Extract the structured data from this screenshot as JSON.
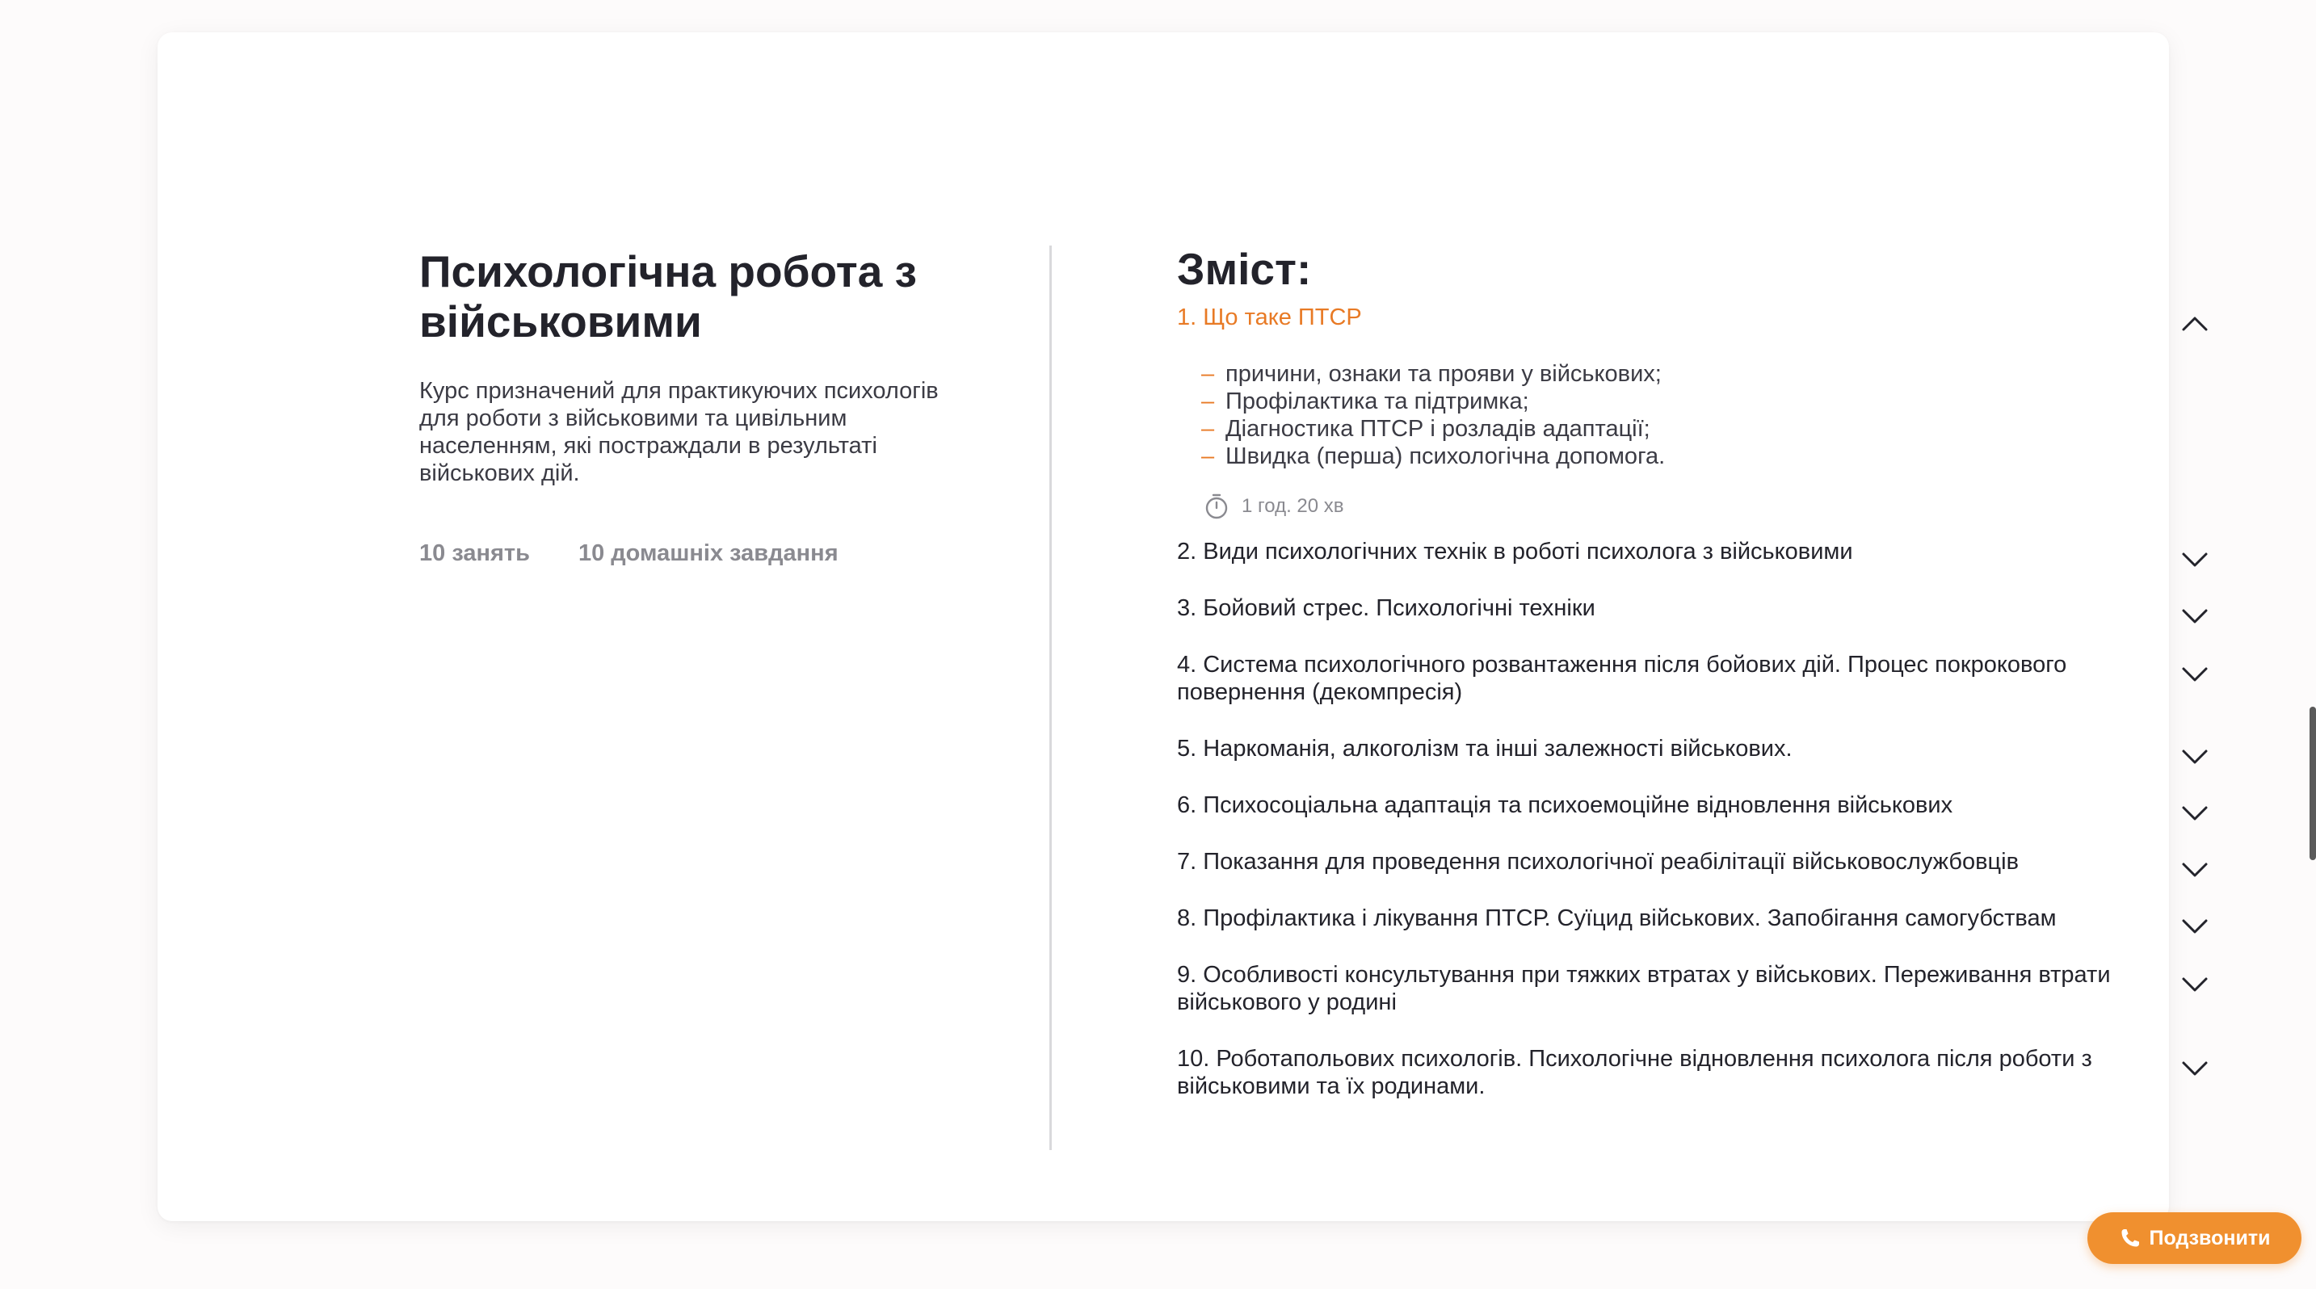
{
  "course": {
    "title": "Психологічна робота з військовими",
    "description": "Курс призначений для практикуючих психологів для роботи з військовими та цивільним населенням, які постраждали в результаті військових дій.",
    "lessons_count": "10 занять",
    "homework_count": "10 домашніх завдання"
  },
  "contents": {
    "heading": "Зміст:",
    "modules": [
      {
        "title": "1. Що таке ПТСР",
        "expanded": true,
        "topics": [
          "причини, ознаки та прояви у військових;",
          "Профілактика та підтримка;",
          "Діагностика ПТСР і розладів адаптації;",
          "Швидка (перша) психологічна допомога."
        ],
        "duration": "1 год. 20 хв"
      },
      {
        "title": "2. Види психологічних технік в роботі психолога з військовими",
        "expanded": false
      },
      {
        "title": "3. Бойовий стрес. Психологічні техніки",
        "expanded": false
      },
      {
        "title": "4. Система психологічного розвантаження після бойових дій. Процес покрокового повернення (декомпресія)",
        "expanded": false
      },
      {
        "title": "5. Наркоманія, алкоголізм та інші залежності військових.",
        "expanded": false
      },
      {
        "title": "6. Психосоціальна адаптація та психоемоційне відновлення військових",
        "expanded": false
      },
      {
        "title": "7. Показання для проведення психологічної реабілітації військовослужбовців",
        "expanded": false
      },
      {
        "title": "8. Профілактика і лікування ПТСР. Суїцид військових. Запобігання самогубствам",
        "expanded": false
      },
      {
        "title": "9. Особливості консультування при тяжких втратах у військових. Переживання втрати військового у родині",
        "expanded": false
      },
      {
        "title": "10. Роботапольових психологів. Психологічне відновлення психолога після роботи з військовими та їх родинами.",
        "expanded": false
      }
    ],
    "topic_bullet": "–"
  },
  "call_button": {
    "label": "Подзвонити",
    "icon": "phone-icon"
  },
  "colors": {
    "accent": "#e87a25",
    "button": "#f0902f",
    "text": "#23232b",
    "muted": "#8a8a90",
    "divider": "#d9d9dc"
  }
}
